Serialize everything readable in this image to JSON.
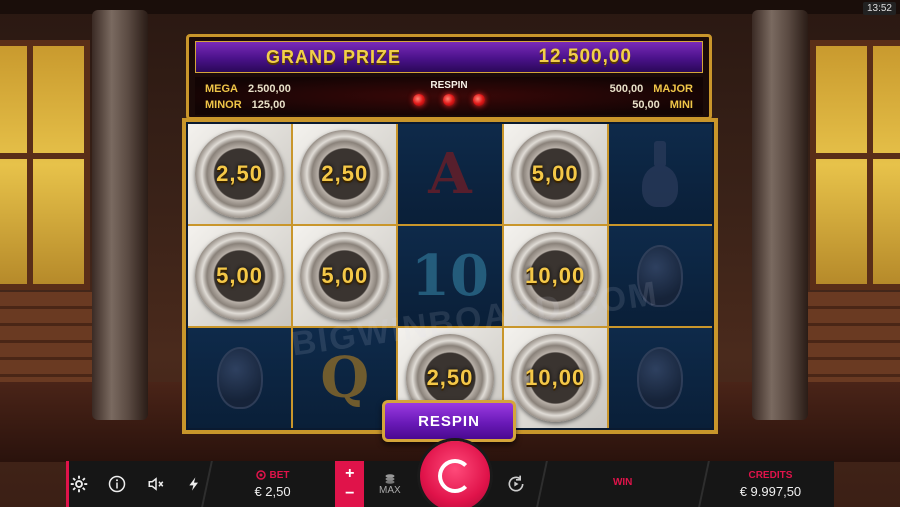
{
  "clock": "13:52",
  "jackpots": {
    "grand_label": "GRAND PRIZE",
    "grand_value": "12.500,00",
    "mega_label": "MEGA",
    "mega_value": "2.500,00",
    "minor_label": "MINOR",
    "minor_value": "125,00",
    "major_label": "MAJOR",
    "major_value": "500,00",
    "mini_label": "MINI",
    "mini_value": "50,00",
    "respin_label": "RESPIN",
    "respins_remaining": 3
  },
  "reels": {
    "rows": [
      [
        {
          "type": "coin",
          "value": "2,50"
        },
        {
          "type": "coin",
          "value": "2,50"
        },
        {
          "type": "symbol",
          "symbol": "A"
        },
        {
          "type": "coin",
          "value": "5,00"
        },
        {
          "type": "icon",
          "symbol": "vase-icon"
        }
      ],
      [
        {
          "type": "coin",
          "value": "5,00"
        },
        {
          "type": "coin",
          "value": "5,00"
        },
        {
          "type": "symbol",
          "symbol": "10"
        },
        {
          "type": "coin",
          "value": "10,00"
        },
        {
          "type": "icon",
          "symbol": "egg-icon"
        }
      ],
      [
        {
          "type": "icon",
          "symbol": "egg-icon"
        },
        {
          "type": "symbol",
          "symbol": "Q"
        },
        {
          "type": "coin",
          "value": "2,50"
        },
        {
          "type": "coin",
          "value": "10,00"
        },
        {
          "type": "icon",
          "symbol": "egg-icon"
        }
      ]
    ]
  },
  "watermark": "BIGWINBOARD.COM",
  "respin_button": "RESPIN",
  "bottom_bar": {
    "bet_label": "BET",
    "bet_value": "€ 2,50",
    "plus": "+",
    "minus": "−",
    "max_label": "MAX",
    "win_label": "WIN",
    "win_value": "",
    "credits_label": "CREDITS",
    "credits_value": "€ 9.997,50"
  },
  "colors": {
    "accent": "#e0134a",
    "gold": "#c9962b",
    "purple": "#6a1ab8"
  }
}
